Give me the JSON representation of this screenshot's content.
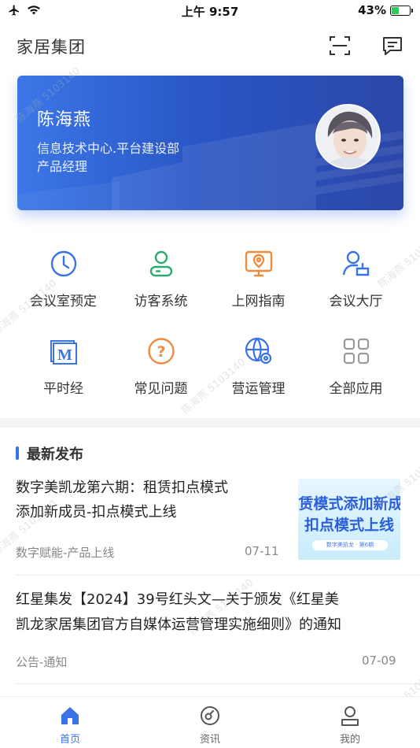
{
  "status_bar": {
    "time": "上午 9:57",
    "battery_percent": "43%",
    "battery_level": 0.43,
    "icons": [
      "airplane-icon",
      "wifi-icon",
      "battery-charging-icon"
    ]
  },
  "header": {
    "title": "家居集团",
    "icons": [
      "scan-icon",
      "message-icon"
    ]
  },
  "profile": {
    "name": "陈海燕",
    "department": "信息技术中心.平台建设部",
    "role": "产品经理"
  },
  "apps": [
    {
      "label": "会议室预定",
      "icon": "clock-icon",
      "color": "#3a73e6"
    },
    {
      "label": "访客系统",
      "icon": "visitor-icon",
      "color": "#2eaa6f"
    },
    {
      "label": "上网指南",
      "icon": "monitor-location-icon",
      "color": "#f08a3c"
    },
    {
      "label": "会议大厅",
      "icon": "meeting-hall-icon",
      "color": "#3a73e6"
    },
    {
      "label": "平时经",
      "icon": "m-book-icon",
      "color": "#3a73e6"
    },
    {
      "label": "常见问题",
      "icon": "question-icon",
      "color": "#f08a3c"
    },
    {
      "label": "营运管理",
      "icon": "globe-gear-icon",
      "color": "#3a73e6"
    },
    {
      "label": "全部应用",
      "icon": "grid-icon",
      "color": "#9a9a9a"
    }
  ],
  "news": {
    "section_title": "最新发布",
    "items": [
      {
        "title": "数字美凯龙第六期：租赁扣点模式添加新成员-扣点模式上线",
        "title_line1": "数字美凯龙第六期：租赁扣点模式",
        "title_line2": "添加新成员-扣点模式上线",
        "category": "数字赋能-产品上线",
        "date": "07-11",
        "thumb_line1": "赁模式添加新成",
        "thumb_line2": "扣点模式上线",
        "thumb_tag": "数字美凯龙 · 第6期"
      },
      {
        "title": "红星集发【2024】39号红头文—关于颁发《红星美凯龙家居集团官方自媒体运营管理实施细则》的通知",
        "title_line1": "红星集发【2024】39号红头文—关于颁发《红星美",
        "title_line2": "凯龙家居集团官方自媒体运营管理实施细则》的通知",
        "category": "公告-通知",
        "date": "07-09"
      }
    ]
  },
  "tabs": [
    {
      "label": "首页",
      "icon": "home-icon",
      "active": true
    },
    {
      "label": "资讯",
      "icon": "news-circle-icon",
      "active": false
    },
    {
      "label": "我的",
      "icon": "user-icon",
      "active": false
    }
  ],
  "watermark": "陈海燕 5103140"
}
